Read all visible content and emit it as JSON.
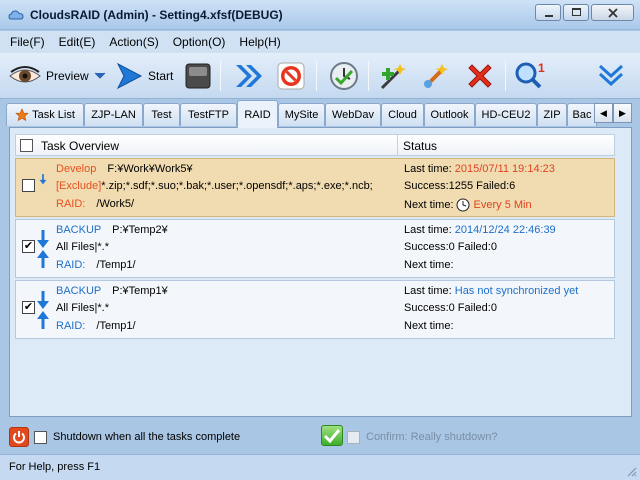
{
  "window": {
    "title": "CloudsRAID (Admin) - Setting4.xfsf(DEBUG)"
  },
  "menu": {
    "items": [
      "File(F)",
      "Edit(E)",
      "Action(S)",
      "Option(O)",
      "Help(H)"
    ]
  },
  "toolbar": {
    "preview_label": "Preview",
    "start_label": "Start"
  },
  "tabs": {
    "items": [
      "Task List",
      "ZJP-LAN",
      "Test",
      "TestFTP",
      "RAID",
      "MySite",
      "WebDav",
      "Cloud",
      "Outlook",
      "HD-CEU2",
      "ZIP",
      "Bac"
    ],
    "active": "RAID"
  },
  "list": {
    "header_task": "Task Overview",
    "header_status": "Status",
    "rows": [
      {
        "name": "Develop",
        "source": "F:¥Work¥Work5¥",
        "exclude_label": "[Exclude]",
        "filter": "*.zip;*.sdf;*.suo;*.bak;*.user;*.opensdf;*.aps;*.exe;*.ncb;",
        "raid_label": "RAID:",
        "raid_path": "/Work5/",
        "last_time_label": "Last time:",
        "last_time": "2015/07/11 19:14:23",
        "result": "Success:1255 Failed:6",
        "next_time_label": "Next time:",
        "next_time": "Every 5 Min",
        "checked": false,
        "highlight": "#f1dcb2"
      },
      {
        "name": "BACKUP",
        "source": "P:¥Temp2¥",
        "filter": "All Files|*.*",
        "raid_label": "RAID:",
        "raid_path": "/Temp1/",
        "last_time_label": "Last time:",
        "last_time": "2014/12/24 22:46:39",
        "result": "Success:0 Failed:0",
        "next_time_label": "Next time:",
        "next_time": "",
        "checked": true
      },
      {
        "name": "BACKUP",
        "source": "P:¥Temp1¥",
        "filter": "All Files|*.*",
        "raid_label": "RAID:",
        "raid_path": "/Temp1/",
        "last_time_label": "Last time:",
        "last_time": "Has not synchronized yet",
        "result": "Success:0 Failed:0",
        "next_time_label": "Next time:",
        "next_time": "",
        "checked": true
      }
    ]
  },
  "bottom": {
    "shutdown_label": "Shutdown when all the tasks complete",
    "confirm_label": "Confirm: Really shutdown?"
  },
  "statusbar": {
    "text": "For Help, press F1"
  },
  "colors": {
    "accent_blue": "#1d6fc9",
    "accent_red": "#e0421d",
    "titlebar": "#a9c8ea"
  }
}
